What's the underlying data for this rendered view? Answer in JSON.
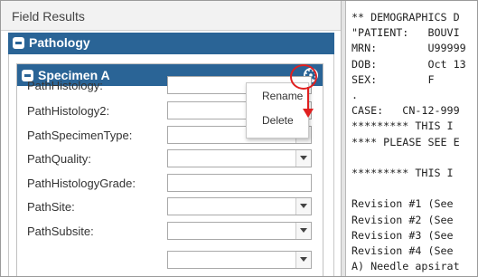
{
  "panel": {
    "title": "Field Results"
  },
  "pathology": {
    "label": "Pathology"
  },
  "specimen": {
    "label": "Specimen A"
  },
  "fields": [
    {
      "label": "PathHistology:",
      "type": "text",
      "value": ""
    },
    {
      "label": "PathHistology2:",
      "type": "text",
      "value": ""
    },
    {
      "label": "PathSpecimenType:",
      "type": "select",
      "value": ""
    },
    {
      "label": "PathQuality:",
      "type": "select",
      "value": ""
    },
    {
      "label": "PathHistologyGrade:",
      "type": "text",
      "value": ""
    },
    {
      "label": "PathSite:",
      "type": "select",
      "value": ""
    },
    {
      "label": "PathSubsite:",
      "type": "select",
      "value": ""
    }
  ],
  "context_menu": {
    "items": [
      "Rename",
      "Delete"
    ]
  },
  "report": {
    "lines": [
      "** DEMOGRAPHICS D",
      "\"PATIENT:   BOUVI",
      "MRN:        U99999",
      "DOB:        Oct 13",
      "SEX:        F",
      ".",
      "CASE:   CN-12-999",
      "********* THIS I",
      "**** PLEASE SEE E",
      "",
      "********* THIS I",
      "",
      "Revision #1 (See",
      "Revision #2 (See",
      "Revision #3 (See",
      "Revision #4 (See",
      "A) Needle apsirat"
    ]
  },
  "colors": {
    "header_blue": "#2a6496",
    "highlight_red": "#e02020"
  }
}
